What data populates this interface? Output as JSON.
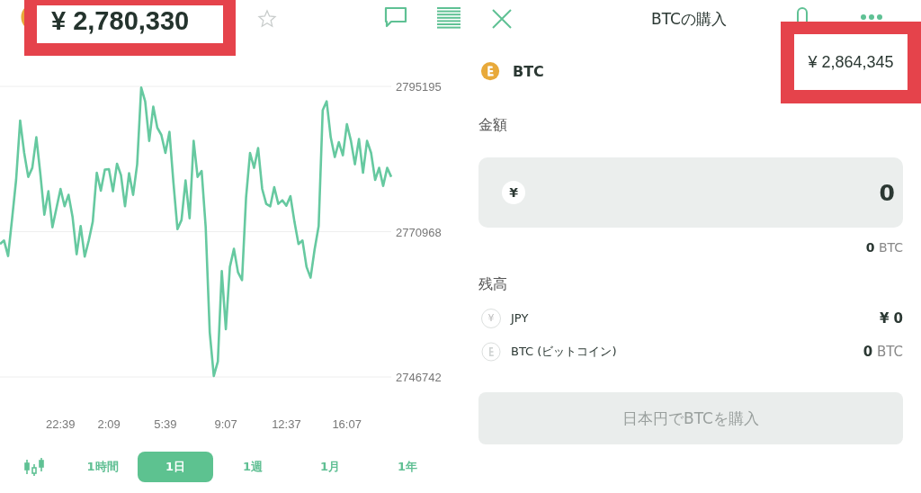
{
  "chart_screen": {
    "price": "¥ 2,780,330",
    "chart_data": {
      "type": "line",
      "categories": [
        null,
        null,
        null,
        null,
        null,
        null,
        null,
        null,
        null,
        null,
        null,
        null,
        null,
        null,
        null,
        "22:39",
        null,
        null,
        null,
        null,
        null,
        null,
        null,
        null,
        null,
        null,
        null,
        "2:09",
        null,
        null,
        null,
        null,
        null,
        null,
        null,
        null,
        null,
        null,
        null,
        null,
        null,
        "5:39",
        null,
        null,
        null,
        null,
        null,
        null,
        null,
        null,
        null,
        null,
        null,
        null,
        null,
        null,
        "9:07",
        null,
        null,
        null,
        null,
        null,
        null,
        null,
        null,
        null,
        null,
        null,
        null,
        null,
        null,
        "12:37",
        null,
        null,
        null,
        null,
        null,
        null,
        null,
        null,
        null,
        null,
        null,
        null,
        null,
        null,
        "16:07",
        null,
        null,
        null,
        null,
        null,
        null,
        null,
        null,
        null,
        null,
        null
      ],
      "series": [
        {
          "color": "#66c9a0",
          "values": [
            2768900,
            2769500,
            2766900,
            2773200,
            2779600,
            2789500,
            2784100,
            2780100,
            2781600,
            2786700,
            2780700,
            2773800,
            2777700,
            2771700,
            2774900,
            2778100,
            2775200,
            2777100,
            2773400,
            2767200,
            2771900,
            2766800,
            2769500,
            2772600,
            2780800,
            2777800,
            2781300,
            2781400,
            2777700,
            2782300,
            2780400,
            2775200,
            2780700,
            2777100,
            2782200,
            2795000,
            2792700,
            2786100,
            2791800,
            2788300,
            2787100,
            2784100,
            2787600,
            2779200,
            2771400,
            2772900,
            2779500,
            2773200,
            2786100,
            2780100,
            2781100,
            2771700,
            2754200,
            2746900,
            2749300,
            2764400,
            2754700,
            2765100,
            2768100,
            2764200,
            2762900,
            2776700,
            2784100,
            2781600,
            2784900,
            2778100,
            2775600,
            2775200,
            2778400,
            2775600,
            2776200,
            2775300,
            2776900,
            2772600,
            2768900,
            2769500,
            2765100,
            2763300,
            2768000,
            2771900,
            2791200,
            2792700,
            2786700,
            2783400,
            2785900,
            2783700,
            2788900,
            2786100,
            2782200,
            2786400,
            2780800,
            2786100,
            2784100,
            2779600,
            2781600,
            2778600,
            2781600,
            2780100
          ]
        }
      ],
      "grid": true,
      "ylim": [
        2746742,
        2795195
      ],
      "yticks": [
        2746742,
        2770968,
        2795195
      ]
    },
    "ranges": [
      {
        "label": "1時間",
        "selected": false
      },
      {
        "label": "1日",
        "selected": true
      },
      {
        "label": "1週",
        "selected": false
      },
      {
        "label": "1月",
        "selected": false
      },
      {
        "label": "1年",
        "selected": false
      }
    ]
  },
  "buy_screen": {
    "title": "BTCの購入",
    "asset": {
      "symbol": "BTC",
      "price": "¥ 2,864,345"
    },
    "amount": {
      "label": "金額",
      "currency_symbol": "¥",
      "value": "0",
      "converted": "0",
      "converted_unit": "BTC"
    },
    "balance": {
      "label": "残高",
      "rows": [
        {
          "kind": "jpy",
          "icon_text": "¥",
          "name": "JPY",
          "value": "¥ 0"
        },
        {
          "kind": "btc",
          "name": "BTC (ビットコイン)",
          "value": "0",
          "unit": "BTC"
        }
      ]
    },
    "submit": {
      "label": "日本円でBTCを購入",
      "disabled": true
    }
  }
}
